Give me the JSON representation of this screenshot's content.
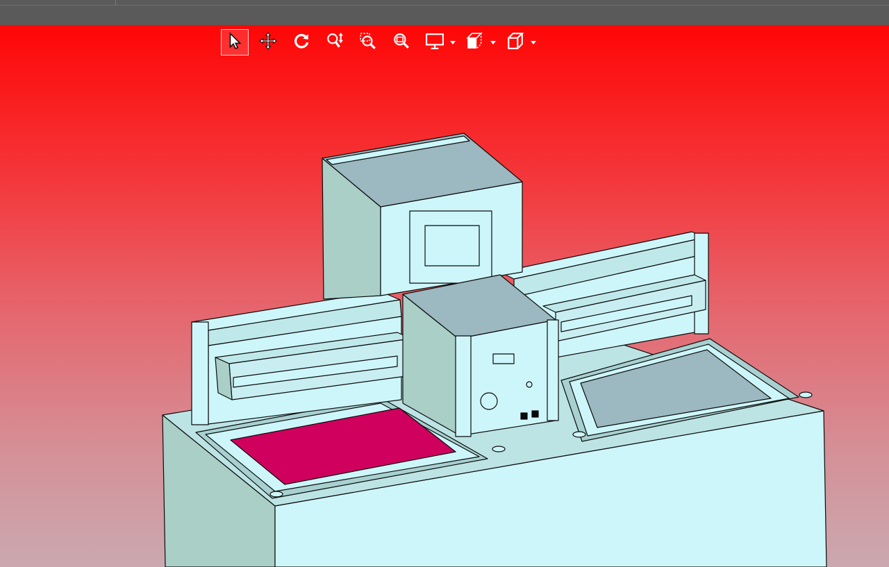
{
  "window": {
    "title": ""
  },
  "toolbar": {
    "tools": [
      {
        "id": "select",
        "icon": "cursor-select-icon",
        "active": true
      },
      {
        "id": "pan",
        "icon": "pan-move-icon",
        "active": false
      },
      {
        "id": "rotate",
        "icon": "rotate-icon",
        "active": false
      },
      {
        "id": "zoom",
        "icon": "zoom-updown-icon",
        "active": false
      },
      {
        "id": "zoom-window",
        "icon": "zoom-window-icon",
        "active": false
      },
      {
        "id": "zoom-fit",
        "icon": "zoom-fit-icon",
        "active": false
      },
      {
        "id": "display",
        "icon": "monitor-display-icon",
        "dropdown": true
      },
      {
        "id": "section",
        "icon": "section-view-icon",
        "dropdown": true
      },
      {
        "id": "view-orientation",
        "icon": "cube-view-icon",
        "dropdown": true
      }
    ]
  },
  "viewport": {
    "background_top": "#ff0606",
    "background_bottom": "#cba8b0",
    "model_colors": {
      "body": "#cdf6fa",
      "side": "#a9cfc6",
      "panel": "#9cb8c0",
      "highlight": "#d0005e",
      "edge": "#0a0a0a"
    }
  }
}
